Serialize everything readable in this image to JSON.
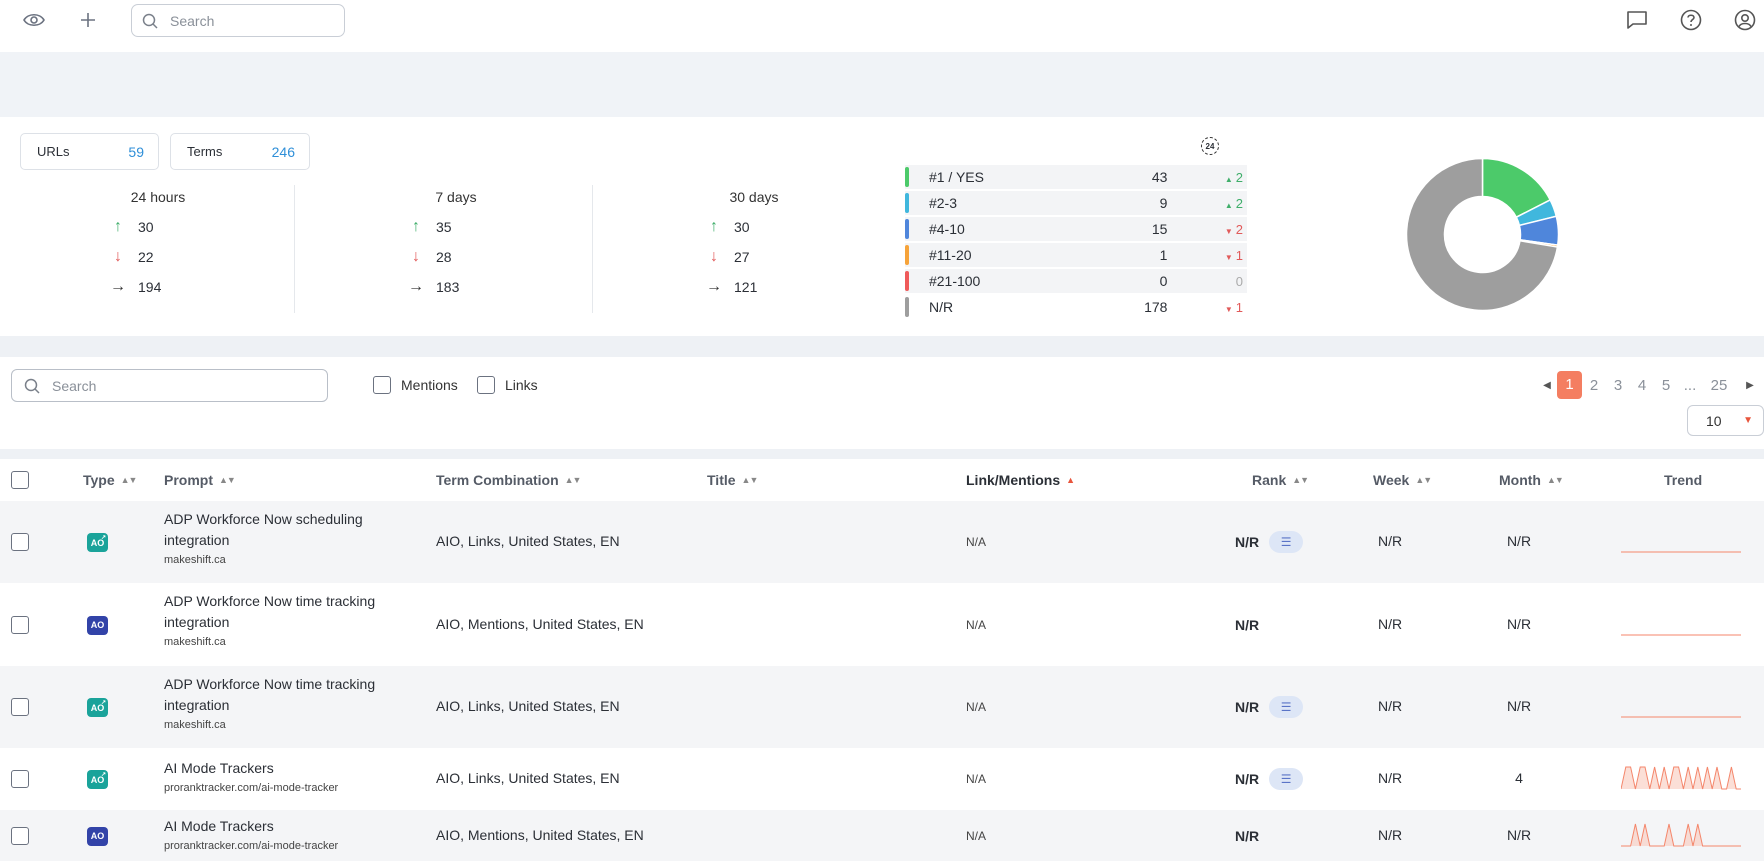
{
  "topbar": {
    "search_placeholder": "Search",
    "icons": [
      "eye-icon",
      "plus-icon",
      "search-icon",
      "chat-icon",
      "help-icon",
      "user-icon"
    ]
  },
  "summary": {
    "urls_label": "URLs",
    "urls_value": "59",
    "terms_label": "Terms",
    "terms_value": "246"
  },
  "periods": [
    {
      "title": "24 hours",
      "up": "30",
      "down": "22",
      "flat": "194"
    },
    {
      "title": "7 days",
      "up": "35",
      "down": "28",
      "flat": "183"
    },
    {
      "title": "30 days",
      "up": "30",
      "down": "27",
      "flat": "121"
    }
  ],
  "rank_badge": "24",
  "rank_buckets": [
    {
      "label": "#1 / YES",
      "count": "43",
      "change": "2",
      "dir": "up",
      "color": "#4cca6a"
    },
    {
      "label": "#2-3",
      "count": "9",
      "change": "2",
      "dir": "up",
      "color": "#40b7dd"
    },
    {
      "label": "#4-10",
      "count": "15",
      "change": "2",
      "dir": "down",
      "color": "#4f86db"
    },
    {
      "label": "#11-20",
      "count": "1",
      "change": "1",
      "dir": "down",
      "color": "#f6a33a"
    },
    {
      "label": "#21-100",
      "count": "0",
      "change": "0",
      "dir": "zero",
      "color": "#ef5a5a"
    },
    {
      "label": "N/R",
      "count": "178",
      "change": "1",
      "dir": "down",
      "color": "#9e9e9e"
    }
  ],
  "filters": {
    "search_placeholder": "Search",
    "mentions_label": "Mentions",
    "links_label": "Links"
  },
  "pagination": {
    "pages": [
      "1",
      "2",
      "3",
      "4",
      "5",
      "...",
      "25"
    ],
    "active": "1",
    "per_page": "10"
  },
  "columns": {
    "type": "Type",
    "prompt": "Prompt",
    "term": "Term Combination",
    "title": "Title",
    "link": "Link/Mentions",
    "rank": "Rank",
    "week": "Week",
    "month": "Month",
    "trend": "Trend"
  },
  "rows": [
    {
      "badge": "AO",
      "badge_style": "teal",
      "prompt_line1": "ADP Workforce Now scheduling",
      "prompt_line2": "integration",
      "domain": "makeshift.ca",
      "term": "AIO, Links, United States, EN",
      "link": "N/A",
      "rank": "N/R",
      "list_btn": true,
      "week": "N/R",
      "month": "N/R",
      "trend": "flat"
    },
    {
      "badge": "AO",
      "badge_style": "navy",
      "prompt_line1": "ADP Workforce Now time tracking",
      "prompt_line2": "integration",
      "domain": "makeshift.ca",
      "term": "AIO, Mentions, United States, EN",
      "link": "N/A",
      "rank": "N/R",
      "list_btn": false,
      "week": "N/R",
      "month": "N/R",
      "trend": "flat"
    },
    {
      "badge": "AO",
      "badge_style": "teal",
      "prompt_line1": "ADP Workforce Now time tracking",
      "prompt_line2": "integration",
      "domain": "makeshift.ca",
      "term": "AIO, Links, United States, EN",
      "link": "N/A",
      "rank": "N/R",
      "list_btn": true,
      "week": "N/R",
      "month": "N/R",
      "trend": "flat"
    },
    {
      "badge": "AO",
      "badge_style": "teal",
      "prompt_line1": "AI Mode Trackers",
      "prompt_line2": "",
      "domain": "proranktracker.com/ai-mode-tracker",
      "term": "AIO, Links, United States, EN",
      "link": "N/A",
      "rank": "N/R",
      "list_btn": true,
      "week": "N/R",
      "month": "4",
      "trend": "spiky-dense"
    },
    {
      "badge": "AO",
      "badge_style": "navy",
      "prompt_line1": "AI Mode Trackers",
      "prompt_line2": "",
      "domain": "proranktracker.com/ai-mode-tracker",
      "term": "AIO, Mentions, United States, EN",
      "link": "N/A",
      "rank": "N/R",
      "list_btn": false,
      "week": "N/R",
      "month": "N/R",
      "trend": "spiky-sparse"
    }
  ],
  "colors": {
    "accent": "#f47e61",
    "link_blue": "#2f8fd8",
    "up": "#3fae6a",
    "down": "#e15a5a",
    "trend": "#f4866b"
  }
}
